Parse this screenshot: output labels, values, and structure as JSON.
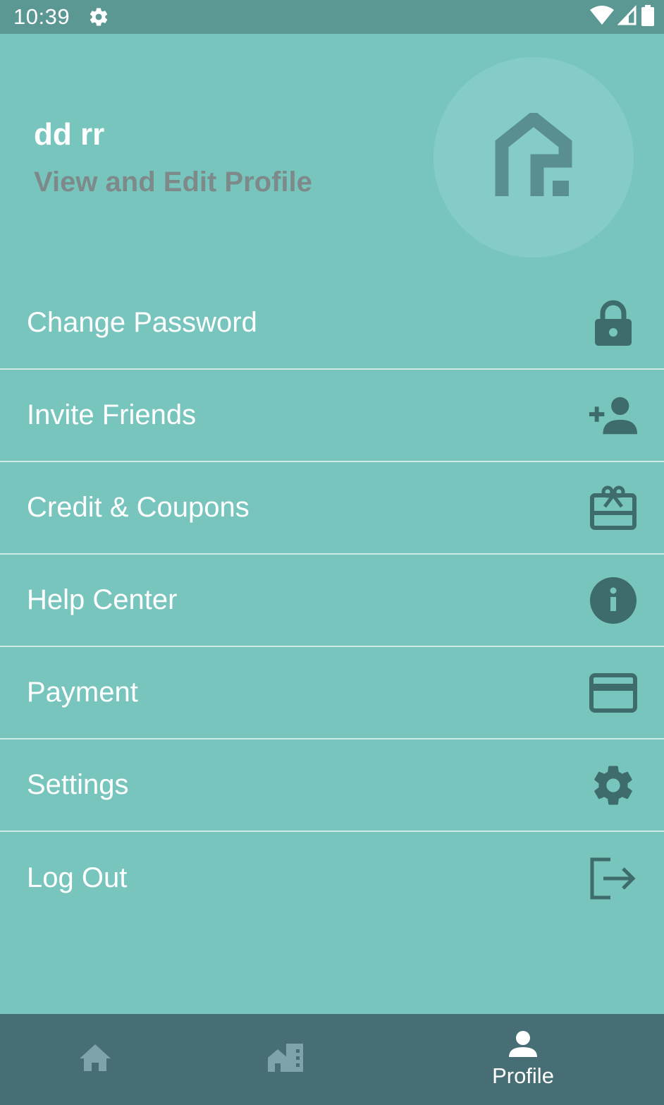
{
  "status_bar": {
    "time": "10:39",
    "icons": [
      "settings-gear-icon",
      "wifi-icon",
      "cell-signal-icon",
      "battery-icon"
    ]
  },
  "header": {
    "user_name": "dd rr",
    "profile_link": "View and Edit Profile",
    "logo_icon": "house-logo-icon"
  },
  "menu": {
    "items": [
      {
        "label": "Change Password",
        "icon": "lock-icon"
      },
      {
        "label": "Invite Friends",
        "icon": "add-person-icon"
      },
      {
        "label": "Credit & Coupons",
        "icon": "gift-card-icon"
      },
      {
        "label": "Help Center",
        "icon": "info-icon"
      },
      {
        "label": "Payment",
        "icon": "credit-card-icon"
      },
      {
        "label": "Settings",
        "icon": "gear-icon"
      },
      {
        "label": "Log Out",
        "icon": "logout-icon"
      }
    ]
  },
  "bottom_nav": {
    "items": [
      {
        "label": "",
        "icon": "home-icon"
      },
      {
        "label": "",
        "icon": "buildings-icon"
      },
      {
        "label": "Profile",
        "icon": "person-icon"
      }
    ]
  },
  "colors": {
    "background": "#78C5BE",
    "status_bar": "#5B9893",
    "bottom_nav": "#476E74",
    "icon_dark": "#3E6B6B",
    "profile_link": "#7E8A8A"
  }
}
